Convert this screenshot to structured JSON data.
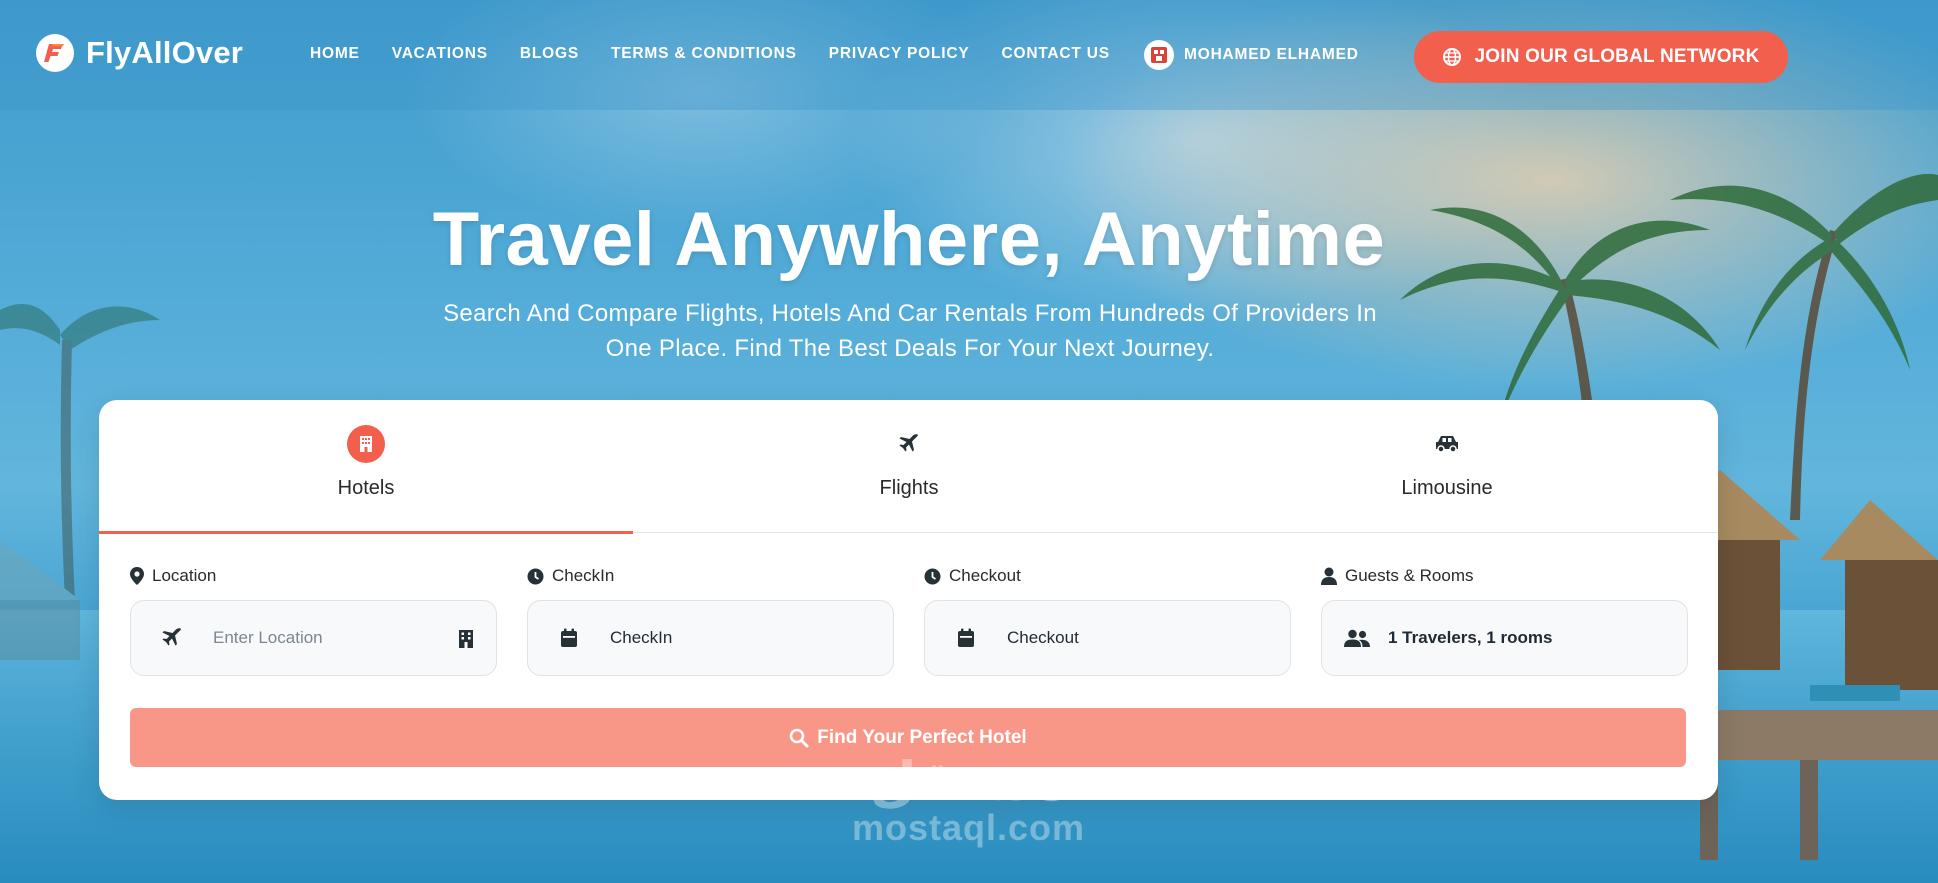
{
  "brand": {
    "name": "FlyAllOver",
    "accent": "#f25f4c"
  },
  "nav": {
    "links": [
      {
        "label": "Home"
      },
      {
        "label": "Vacations"
      },
      {
        "label": "Blogs"
      },
      {
        "label": "Terms & Conditions"
      },
      {
        "label": "Privacy Policy"
      },
      {
        "label": "Contact Us"
      }
    ],
    "user_name": "Mohamed Elhamed",
    "join_label": "JOIN OUR GLOBAL NETWORK"
  },
  "hero": {
    "title": "Travel Anywhere, Anytime",
    "subtitle_line1": "Search And Compare Flights, Hotels And Car Rentals From Hundreds Of Providers In",
    "subtitle_line2": "One Place. Find The Best Deals For Your Next Journey."
  },
  "search": {
    "tabs": [
      {
        "label": "Hotels",
        "icon": "hotel-icon",
        "active": true
      },
      {
        "label": "Flights",
        "icon": "plane-icon",
        "active": false
      },
      {
        "label": "Limousine",
        "icon": "car-icon",
        "active": false
      }
    ],
    "fields": {
      "location": {
        "label": "Location",
        "placeholder": "Enter Location",
        "icon": "location-pin-icon"
      },
      "checkin": {
        "label": "CheckIn",
        "value": "CheckIn",
        "icon": "clock-icon"
      },
      "checkout": {
        "label": "Checkout",
        "value": "Checkout",
        "icon": "clock-icon"
      },
      "guests": {
        "label": "Guests & Rooms",
        "value": "1 Travelers, 1 rooms",
        "icon": "user-icon"
      }
    },
    "submit_label": "Find Your Perfect Hotel"
  },
  "watermark": {
    "arabic": "مستقل",
    "latin": "mostaql.com"
  }
}
